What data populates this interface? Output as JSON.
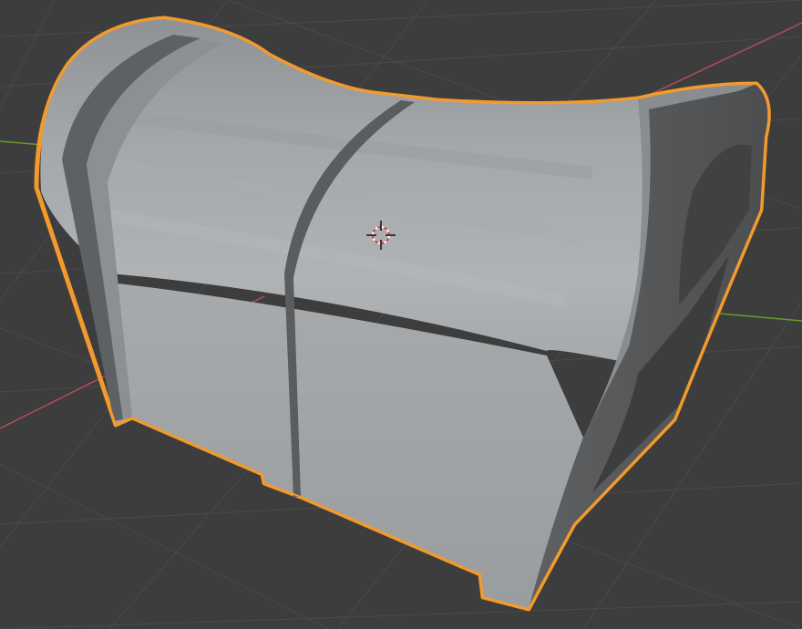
{
  "viewport": {
    "background_color": "#3d3d3d",
    "grid_color": "#4a4a4a",
    "x_axis_color": "#b34c58",
    "y_axis_color": "#6a9a2a",
    "selection_outline_color": "#f29a2e",
    "selected_object": {
      "shape": "treasure-chest",
      "state": "selected",
      "base_color": "#9da0a2"
    },
    "cursor_icon": "3d-cursor-icon"
  }
}
